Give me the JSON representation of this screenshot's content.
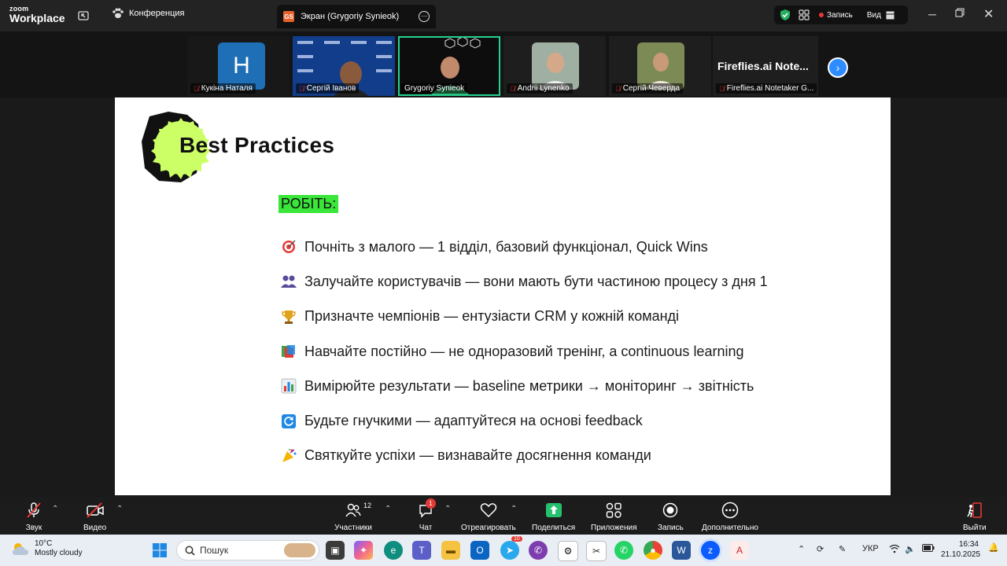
{
  "app": {
    "logo_top": "zoom",
    "logo_bottom": "Workplace"
  },
  "header": {
    "conference_label": "Конференция",
    "share_tab": {
      "initials": "GS",
      "title": "Экран (Grygoriy Synieok)"
    },
    "recording_label": "Запись",
    "view_label": "Вид"
  },
  "participants": [
    {
      "name": "Кукіна Наталя",
      "avatar_letter": "H",
      "muted": true
    },
    {
      "name": "Сергій Іванов",
      "muted": true
    },
    {
      "name": "Grygoriy Synieok",
      "muted": false,
      "active": true
    },
    {
      "name": "Andrii Lynenko",
      "muted": true
    },
    {
      "name": "Сергій Чеверда",
      "muted": true
    },
    {
      "name": "Fireflies.ai Notetaker G...",
      "tile_title": "Fireflies.ai Note...",
      "muted": true
    }
  ],
  "slide": {
    "title": "Best Practices",
    "section_label": "РОБІТЬ:",
    "section_highlight_color": "#39e639",
    "badge_color": "#ccff66",
    "items": [
      {
        "icon": "dart-icon",
        "text": "Почніть з малого — 1 відділ, базовий функціонал, Quick Wins"
      },
      {
        "icon": "people-icon",
        "text": "Залучайте користувачів — вони мають бути частиною процесу з дня 1"
      },
      {
        "icon": "trophy-icon",
        "text": "Призначте чемпіонів — ентузіасти CRM у кожній команді"
      },
      {
        "icon": "books-icon",
        "text": "Навчайте постійно — не одноразовий тренінг, а continuous learning"
      },
      {
        "icon": "bar-chart-icon",
        "text": "Вимірюйте результати — baseline метрики → моніторинг → звітність"
      },
      {
        "icon": "refresh-icon",
        "text": "Будьте гнучкими — адаптуйтеся на основі feedback"
      },
      {
        "icon": "party-icon",
        "text": "Святкуйте успіхи — визнавайте досягнення команди"
      }
    ]
  },
  "toolbar": {
    "audio": "Звук",
    "video": "Видео",
    "participants": "Участники",
    "participants_count": "12",
    "chat": "Чат",
    "chat_badge": "1",
    "react": "Отреагировать",
    "share": "Поделиться",
    "apps": "Приложения",
    "record": "Запись",
    "more": "Дополнительно",
    "leave": "Выйти"
  },
  "taskbar": {
    "temperature": "10°C",
    "weather": "Mostly cloudy",
    "search_placeholder": "Пошук",
    "telegram_badge": "10",
    "language": "УКР",
    "time": "16:34",
    "date": "21.10.2025"
  }
}
